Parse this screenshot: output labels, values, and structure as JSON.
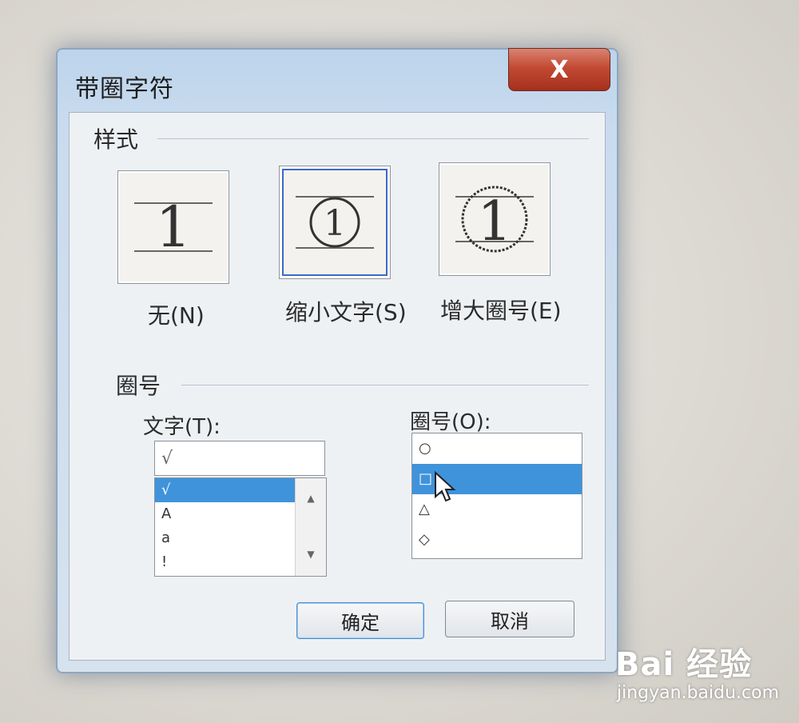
{
  "dialog": {
    "title": "带圈字符",
    "close_label": "X"
  },
  "style_section": {
    "label": "样式",
    "options": [
      {
        "label": "无(N)",
        "selected": false
      },
      {
        "label": "缩小文字(S)",
        "selected": true
      },
      {
        "label": "增大圈号(E)",
        "selected": false
      }
    ],
    "preview_char": "1"
  },
  "enclosure_section": {
    "label": "圈号",
    "text_label": "文字(T):",
    "text_value": "√",
    "text_list": [
      "√",
      "A",
      "a",
      "!"
    ],
    "text_selected_index": 0,
    "shape_label": "圈号(O):",
    "shape_list": [
      "○",
      "□",
      "△",
      "◇"
    ],
    "shape_selected_index": 1
  },
  "buttons": {
    "ok": "确定",
    "cancel": "取消"
  },
  "watermark": {
    "logo": "Bai 经验",
    "url": "jingyan.baidu.com"
  },
  "colors": {
    "selection": "#3f93db",
    "focus": "#3d69c7",
    "close": "#c24a33"
  }
}
